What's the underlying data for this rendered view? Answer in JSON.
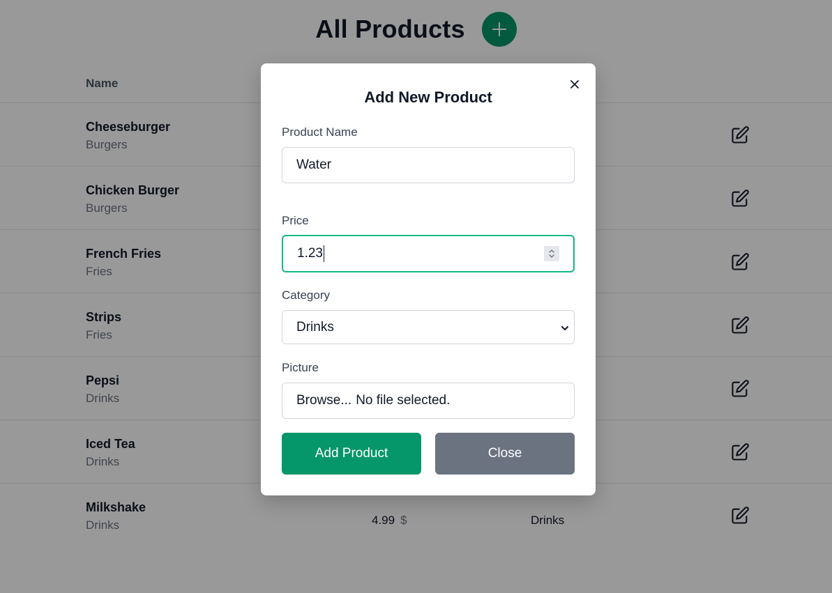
{
  "header": {
    "title": "All Products"
  },
  "table": {
    "column_name": "Name",
    "rows": [
      {
        "name": "Cheeseburger",
        "category": "Burgers"
      },
      {
        "name": "Chicken Burger",
        "category": "Burgers"
      },
      {
        "name": "French Fries",
        "category": "Fries"
      },
      {
        "name": "Strips",
        "category": "Fries"
      },
      {
        "name": "Pepsi",
        "category": "Drinks"
      },
      {
        "name": "Iced Tea",
        "category": "Drinks"
      },
      {
        "name": "Milkshake",
        "category": "Drinks",
        "price": "4.99",
        "currency": "$",
        "category_col": "Drinks"
      }
    ]
  },
  "modal": {
    "title": "Add New Product",
    "product_name_label": "Product Name",
    "product_name_value": "Water",
    "price_label": "Price",
    "price_value": "1.23",
    "category_label": "Category",
    "category_value": "Drinks",
    "picture_label": "Picture",
    "picture_browse": "Browse...",
    "picture_status": "No file selected.",
    "add_button": "Add Product",
    "close_button": "Close"
  },
  "colors": {
    "brand_green": "#059669",
    "focus_ring": "#10b981",
    "secondary_gray": "#6b7280"
  },
  "icons": {
    "add": "plus-icon",
    "edit": "edit-icon",
    "close": "close-icon",
    "stepper": "spinner-icon",
    "select": "chevron-down-icon"
  }
}
